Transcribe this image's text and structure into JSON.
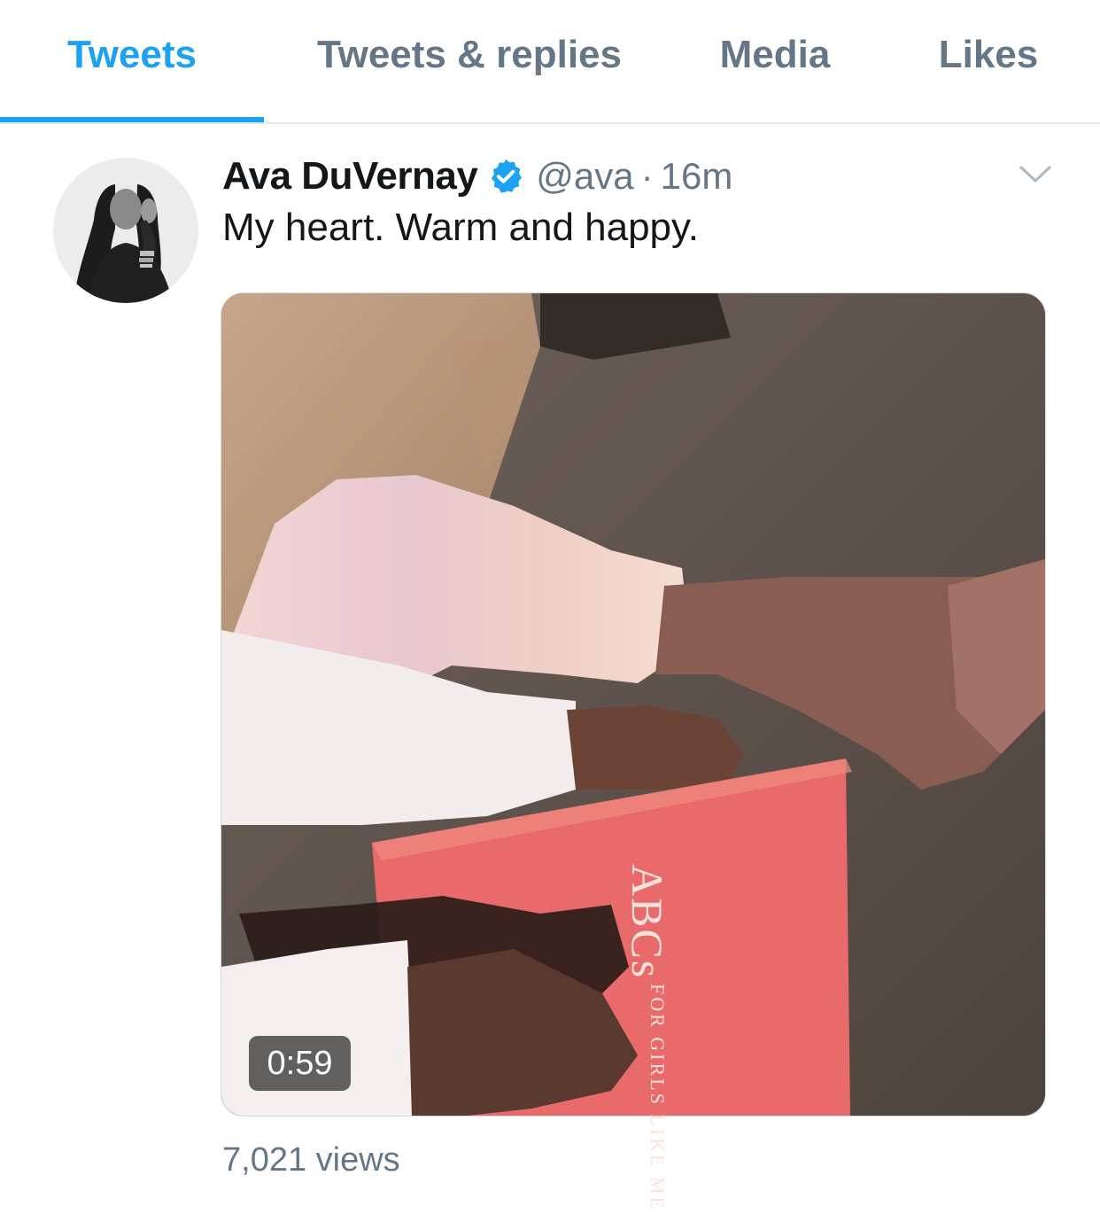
{
  "tabs": [
    {
      "label": "Tweets",
      "active": true
    },
    {
      "label": "Tweets & replies",
      "active": false
    },
    {
      "label": "Media",
      "active": false
    },
    {
      "label": "Likes",
      "active": false
    }
  ],
  "tweet": {
    "display_name": "Ava DuVernay",
    "verified": true,
    "handle": "@ava",
    "separator": "·",
    "time": "16m",
    "text": "My heart. Warm and happy.",
    "media": {
      "type": "video",
      "duration": "0:59",
      "book_title": "ABCs",
      "book_subtitle": "FOR GIRLS LIKE ME"
    },
    "views": "7,021 views"
  },
  "colors": {
    "accent": "#1da1f2",
    "text_primary": "#14171a",
    "text_secondary": "#657786",
    "divider": "#e1e8ed"
  },
  "icons": [
    "verified-badge-icon",
    "chevron-down-icon"
  ]
}
